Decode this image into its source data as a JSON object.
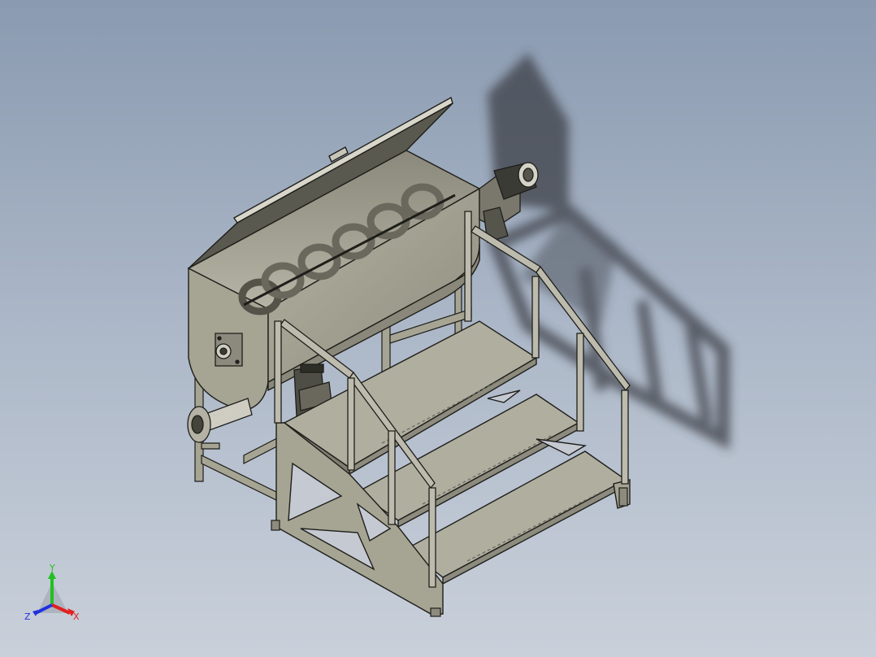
{
  "axes": {
    "y_label": "Y",
    "x_label": "X",
    "z_label": "Z",
    "x_color": "#e02020",
    "y_color": "#22c022",
    "z_color": "#2030e0"
  },
  "colors": {
    "background_top": "#8a9ab0",
    "background_bottom": "#c9d0da",
    "metal": "#a6a493",
    "metal_dark": "#6f6e62",
    "edge": "#1e1e1a",
    "shadow": "#3c3f47"
  }
}
